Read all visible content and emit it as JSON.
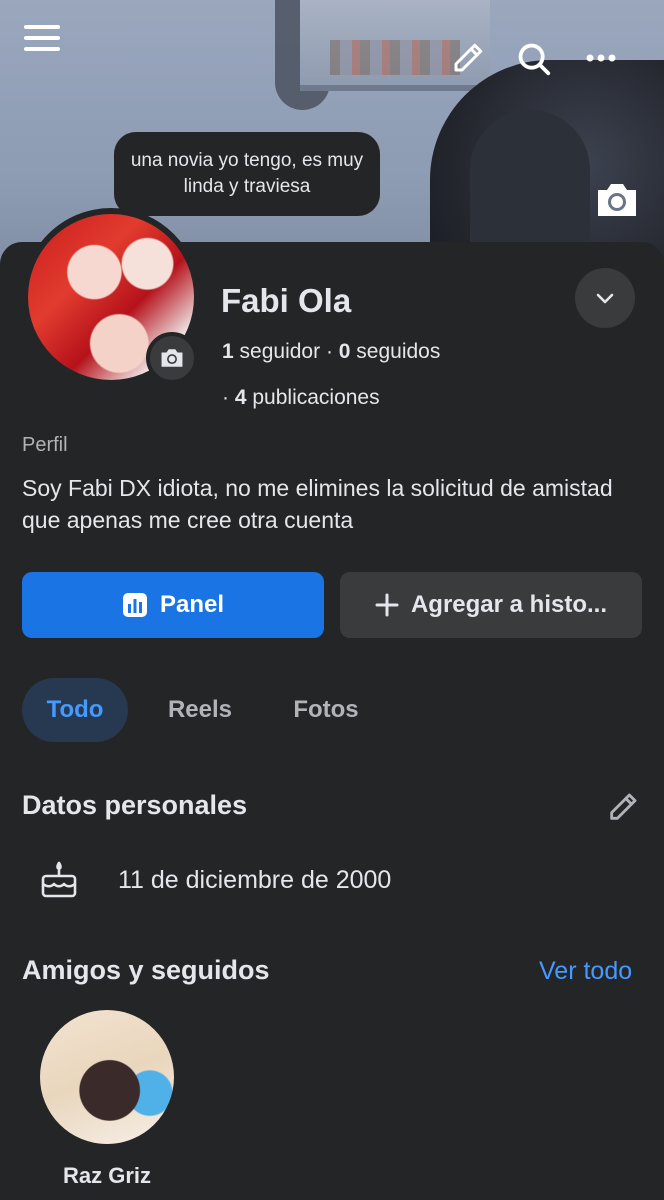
{
  "cover": {
    "note_text": "una novia yo tengo, es muy linda y traviesa"
  },
  "profile": {
    "name": "Fabi Ola",
    "followers_count": "1",
    "followers_label": "seguidor",
    "following_count": "0",
    "following_label": "seguidos",
    "posts_count": "4",
    "posts_label": "publicaciones",
    "category": "Perfil",
    "bio": "Soy Fabi DX idiota, no me elimines la solicitud de amistad que apenas me cree otra cuenta"
  },
  "actions": {
    "panel_label": "Panel",
    "add_story_label": "Agregar a histo..."
  },
  "tabs": [
    {
      "label": "Todo",
      "active": true
    },
    {
      "label": "Reels",
      "active": false
    },
    {
      "label": "Fotos",
      "active": false
    }
  ],
  "personal": {
    "title": "Datos personales",
    "birthday": "11 de diciembre de 2000"
  },
  "friends": {
    "title": "Amigos y seguidos",
    "see_all": "Ver todo",
    "items": [
      {
        "name": "Raz Griz"
      }
    ]
  },
  "colors": {
    "background": "#242526",
    "primary": "#1b74e4",
    "link": "#4599ff",
    "secondary_button": "#3a3b3c",
    "active_tab_bg": "#263951"
  }
}
